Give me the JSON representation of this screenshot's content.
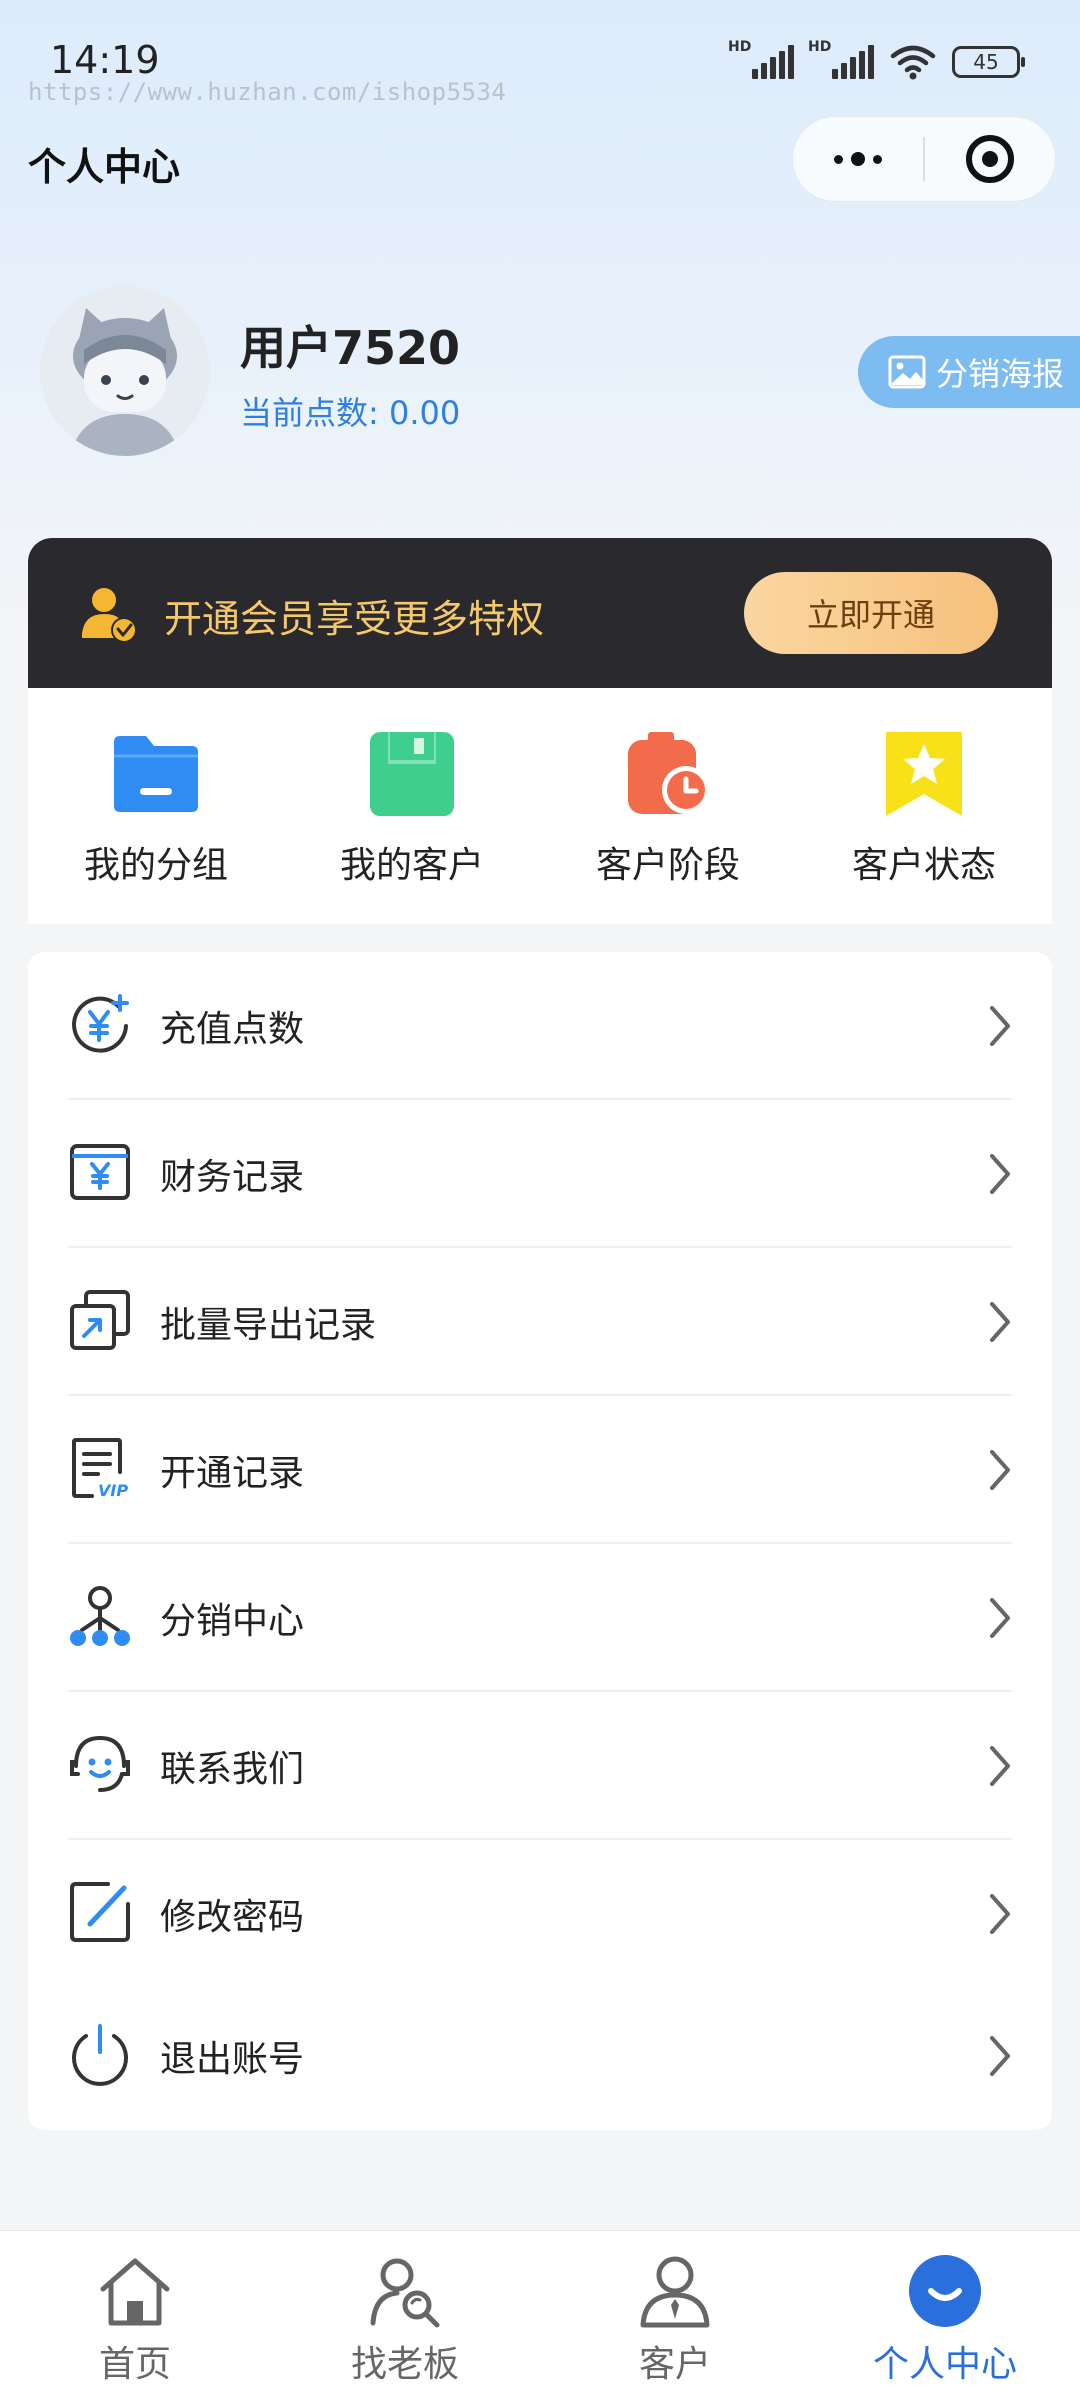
{
  "status_bar": {
    "time": "14:19",
    "watermark": "https://www.huzhan.com/ishop5534",
    "battery": "45",
    "hd_label": "HD"
  },
  "header": {
    "title": "个人中心"
  },
  "profile": {
    "username": "用户7520",
    "points_text": "当前点数: 0.00",
    "poster_label": "分销海报"
  },
  "member": {
    "text": "开通会员享受更多特权",
    "button": "立即开通",
    "accent_color": "#f5c86b"
  },
  "quick_actions": [
    {
      "label": "我的分组",
      "icon": "folder-icon",
      "color": "#2f8cf2"
    },
    {
      "label": "我的客户",
      "icon": "save-icon",
      "color": "#3ecf8e"
    },
    {
      "label": "客户阶段",
      "icon": "clock-icon",
      "color": "#f26b4a"
    },
    {
      "label": "客户状态",
      "icon": "star-bookmark-icon",
      "color": "#f9e11a"
    }
  ],
  "menu": [
    {
      "label": "充值点数",
      "icon": "recharge-icon"
    },
    {
      "label": "财务记录",
      "icon": "finance-icon"
    },
    {
      "label": "批量导出记录",
      "icon": "export-icon"
    },
    {
      "label": "开通记录",
      "icon": "vip-record-icon"
    },
    {
      "label": "分销中心",
      "icon": "distribution-icon"
    },
    {
      "label": "联系我们",
      "icon": "headset-icon"
    },
    {
      "label": "修改密码",
      "icon": "edit-icon"
    },
    {
      "label": "退出账号",
      "icon": "power-icon"
    }
  ],
  "tabs": [
    {
      "label": "首页",
      "icon": "home-icon",
      "active": false
    },
    {
      "label": "找老板",
      "icon": "find-boss-icon",
      "active": false
    },
    {
      "label": "客户",
      "icon": "customer-icon",
      "active": false
    },
    {
      "label": "个人中心",
      "icon": "profile-icon",
      "active": true
    }
  ],
  "colors": {
    "primary": "#2a6fdc",
    "icon_blue": "#2f8cf2"
  }
}
